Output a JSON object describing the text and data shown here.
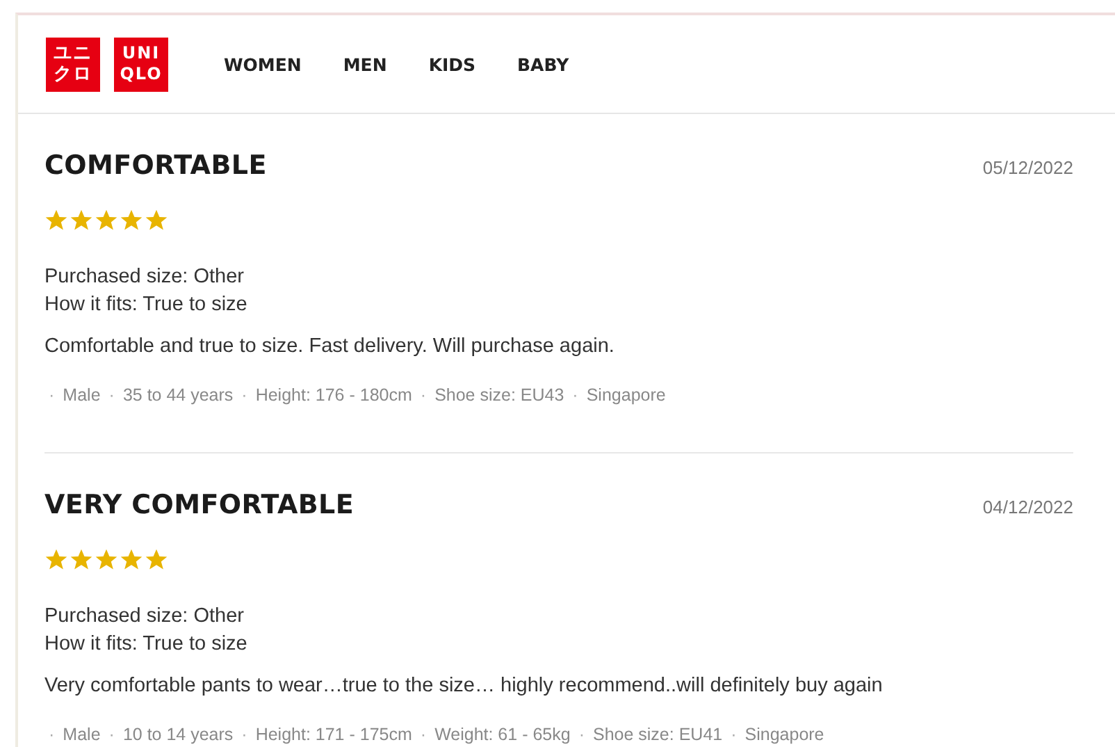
{
  "header": {
    "logo": {
      "katakana": [
        "ユニ",
        "クロ"
      ],
      "latin": [
        "UNI",
        "QLO"
      ]
    },
    "nav": [
      {
        "label": "WOMEN"
      },
      {
        "label": "MEN"
      },
      {
        "label": "KIDS"
      },
      {
        "label": "BABY"
      }
    ]
  },
  "reviews": [
    {
      "title": "COMFORTABLE",
      "date": "05/12/2022",
      "stars": 5,
      "purchased_size": "Purchased size: Other",
      "fit": "How it fits: True to size",
      "body": "Comfortable and true to size. Fast delivery. Will purchase again.",
      "separator": "·",
      "reviewer": [
        "Male",
        "35 to 44 years",
        "Height: 176 - 180cm",
        "Shoe size: EU43",
        "Singapore"
      ]
    },
    {
      "title": "VERY COMFORTABLE",
      "date": "04/12/2022",
      "stars": 5,
      "purchased_size": "Purchased size: Other",
      "fit": "How it fits: True to size",
      "body": "Very comfortable pants to wear…true to the size… highly recommend..will definitely buy again",
      "separator": "·",
      "reviewer": [
        "Male",
        "10 to 14 years",
        "Height: 171 - 175cm",
        "Weight: 61 - 65kg",
        "Shoe size: EU41",
        "Singapore"
      ]
    }
  ]
}
